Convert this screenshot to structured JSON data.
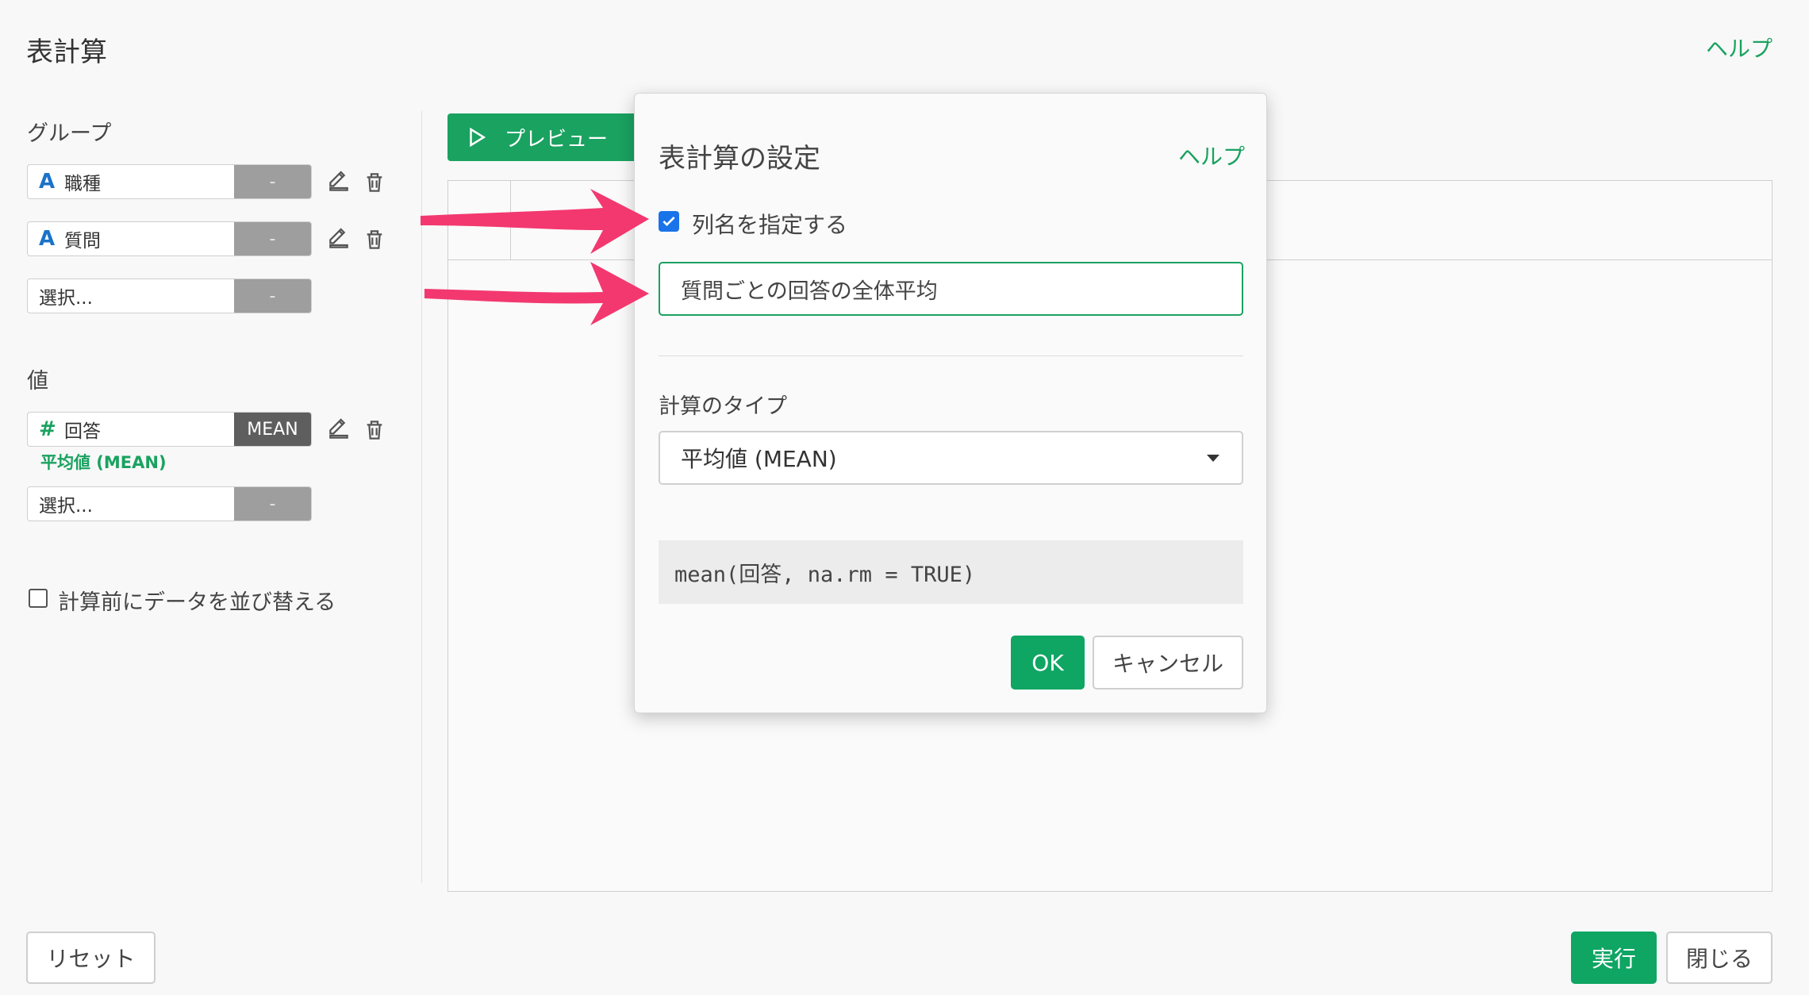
{
  "header": {
    "title": "表計算",
    "help": "ヘルプ"
  },
  "group": {
    "label": "グループ",
    "fields": [
      {
        "type_icon": "A",
        "name": "職種",
        "agg": "-"
      },
      {
        "type_icon": "A",
        "name": "質問",
        "agg": "-"
      }
    ],
    "select": {
      "name": "選択...",
      "agg": "-"
    }
  },
  "value": {
    "label": "値",
    "field": {
      "type_icon": "#",
      "name": "回答",
      "agg": "MEAN",
      "caption": "平均値 (MEAN)"
    },
    "select": {
      "name": "選択...",
      "agg": "-"
    }
  },
  "sort_option": {
    "label": "計算前にデータを並び替える",
    "checked": false
  },
  "preview_button": "プレビュー",
  "footer": {
    "reset": "リセット",
    "run": "実行",
    "close": "閉じる"
  },
  "modal": {
    "title": "表計算の設定",
    "help": "ヘルプ",
    "specify_name_label": "列名を指定する",
    "specify_name_checked": true,
    "name_value": "質問ごとの回答の全体平均",
    "calc_type_label": "計算のタイプ",
    "calc_type_value": "平均値 (MEAN)",
    "code": "mean(回答, na.rm = TRUE)",
    "ok": "OK",
    "cancel": "キャンセル"
  },
  "colors": {
    "accent": "#1aa260",
    "checkbox": "#1a73e8",
    "arrow": "#f3386f"
  }
}
